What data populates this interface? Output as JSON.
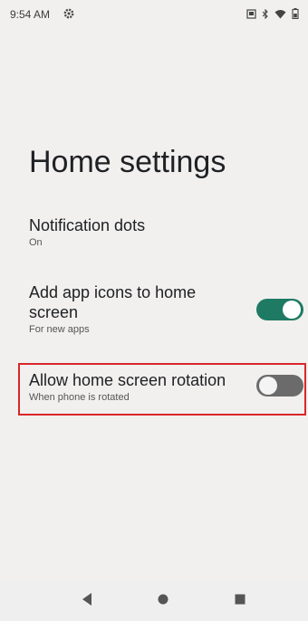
{
  "status_bar": {
    "time": "9:54 AM",
    "left_icon": "gear-icon",
    "right_icons": [
      "cast-icon",
      "bluetooth-icon",
      "wifi-icon",
      "battery-icon"
    ]
  },
  "page": {
    "title": "Home settings"
  },
  "settings": {
    "notification_dots": {
      "title": "Notification dots",
      "subtitle": "On"
    },
    "add_app_icons": {
      "title": "Add app icons to home screen",
      "subtitle": "For new apps",
      "toggle_state": "on"
    },
    "allow_rotation": {
      "title": "Allow home screen rotation",
      "subtitle": "When phone is rotated",
      "toggle_state": "off",
      "highlighted": true
    }
  },
  "nav_bar": {
    "buttons": [
      "back-icon",
      "home-icon",
      "recents-icon"
    ]
  },
  "colors": {
    "toggle_on": "#1e7a63",
    "toggle_off": "#6b6b6b",
    "highlight": "#d9262a",
    "background": "#f1f0ef"
  }
}
